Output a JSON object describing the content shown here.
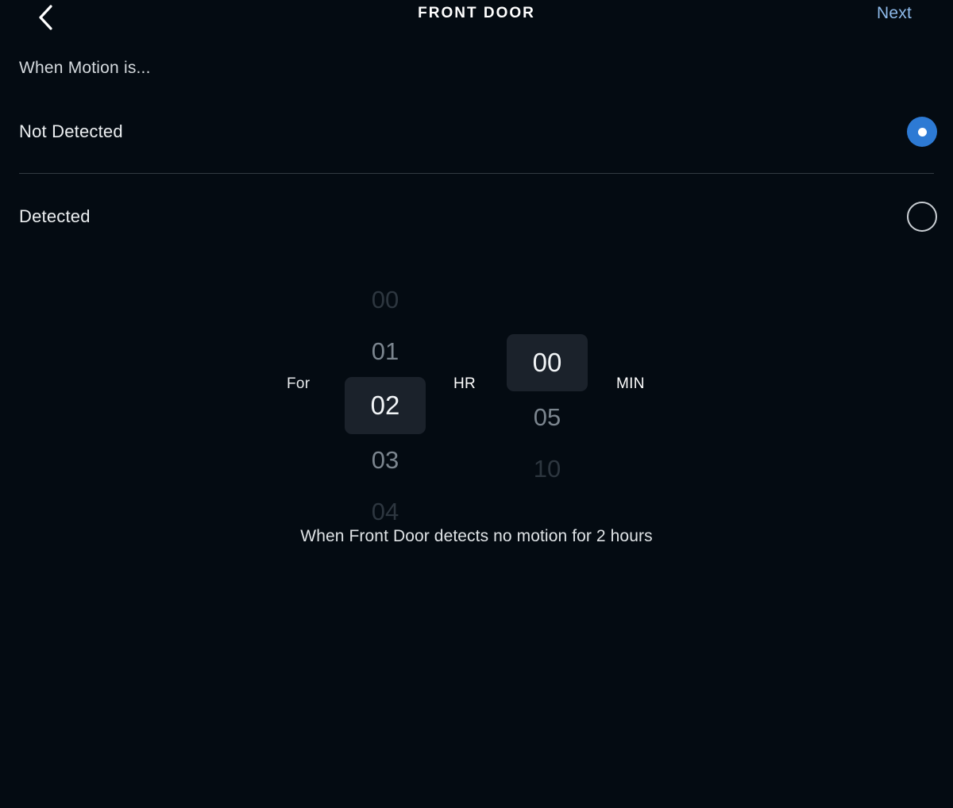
{
  "header": {
    "title": "FRONT DOOR",
    "back_icon": "chevron-left-icon",
    "next_label": "Next"
  },
  "section": {
    "label": "When Motion is..."
  },
  "options": [
    {
      "label": "Not Detected",
      "selected": true
    },
    {
      "label": "Detected",
      "selected": false
    }
  ],
  "duration_picker": {
    "prefix_label": "For",
    "hours": {
      "unit_label": "HR",
      "selected": "02",
      "items": [
        "00",
        "01",
        "02",
        "03",
        "04"
      ]
    },
    "minutes": {
      "unit_label": "MIN",
      "selected": "00",
      "items": [
        "00",
        "05",
        "10"
      ]
    }
  },
  "summary": {
    "text": "When Front Door detects no motion for 2 hours"
  },
  "colors": {
    "background": "#040b12",
    "accent_blue": "#2d7ad4",
    "link_blue": "#8ebaea",
    "selected_pill": "#1b222b",
    "divider": "#323a42"
  }
}
